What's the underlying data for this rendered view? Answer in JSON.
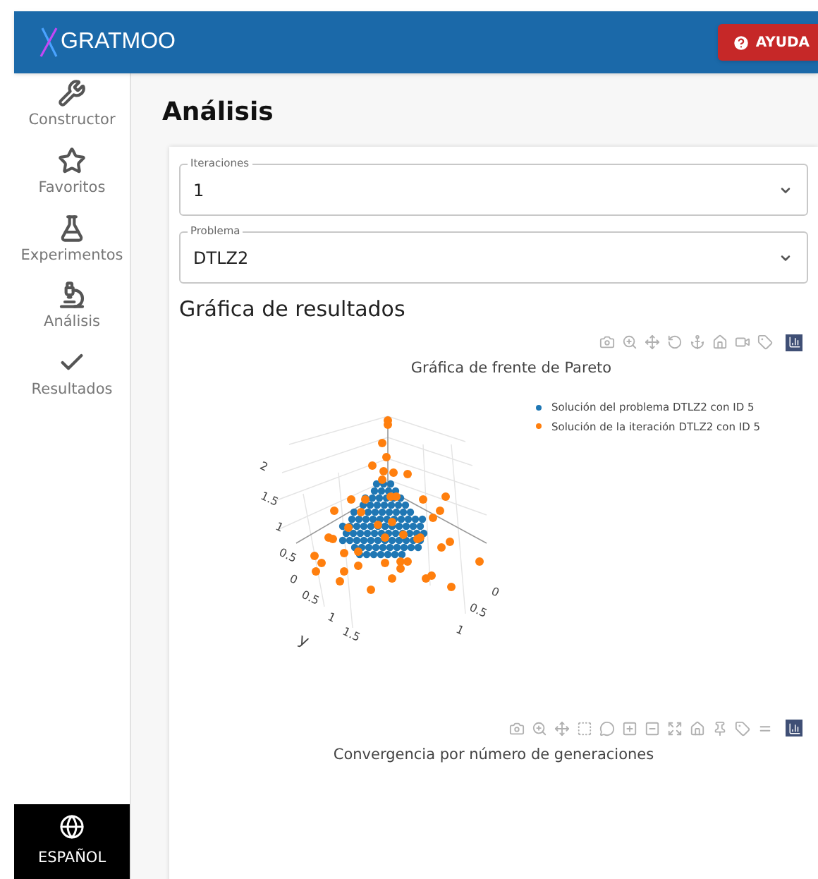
{
  "header": {
    "logo_text": "GRATMOO",
    "help_button": "AYUDA"
  },
  "sidebar": {
    "items": [
      {
        "label": "Constructor"
      },
      {
        "label": "Favoritos"
      },
      {
        "label": "Experimentos"
      },
      {
        "label": "Análisis"
      },
      {
        "label": "Resultados"
      }
    ],
    "language": "ESPAÑOL"
  },
  "page_title": "Análisis",
  "selects": [
    {
      "label": "Iteraciones",
      "value": "1"
    },
    {
      "label": "Problema",
      "value": "DTLZ2"
    }
  ],
  "section_title": "Gráfica de resultados",
  "charts": [
    {
      "title": "Gráfica de frente de Pareto",
      "legend": [
        {
          "label": "Solución del problema DTLZ2 con ID 5",
          "color": "#1f77b4"
        },
        {
          "label": "Solución de la iteración DTLZ2 con ID 5",
          "color": "#ff7f0e"
        }
      ],
      "tick_labels": [
        "2",
        "1.5",
        "1",
        "0.5",
        "0",
        "0.5",
        "1",
        "1.5",
        "y",
        "0",
        "0.5",
        "1"
      ]
    },
    {
      "title": "Convergencia por número de generaciones"
    }
  ]
}
